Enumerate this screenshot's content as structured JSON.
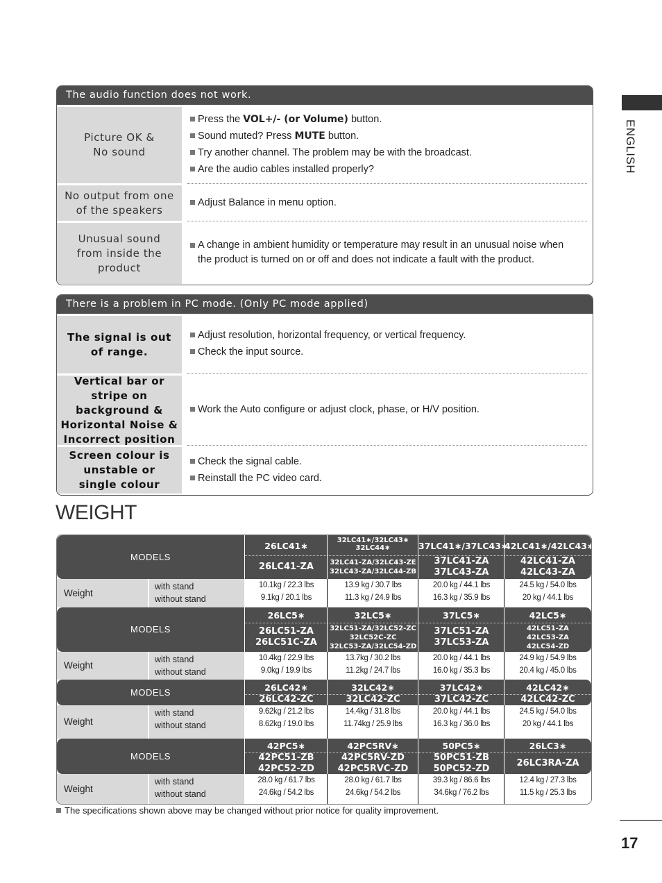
{
  "sidebar": {
    "language": "ENGLISH"
  },
  "page_number": "17",
  "audio_panel": {
    "title": "The audio function does not work.",
    "rows": [
      {
        "problem": "Picture OK & No sound",
        "solutions": [
          {
            "pre": "Press the ",
            "bold": "VOL+/- (or Volume)",
            "post": " button."
          },
          {
            "pre": "Sound muted? Press ",
            "bold": "MUTE",
            "post": " button."
          },
          {
            "pre": "Try another channel. The problem may be with the broadcast.",
            "bold": "",
            "post": ""
          },
          {
            "pre": "Are the audio cables installed properly?",
            "bold": "",
            "post": ""
          }
        ]
      },
      {
        "problem": "No output from one of the speakers",
        "solutions": [
          {
            "pre": "Adjust Balance in menu option.",
            "bold": "",
            "post": ""
          }
        ]
      },
      {
        "problem": "Unusual sound from inside the product",
        "solutions": [
          {
            "pre": "A change in ambient humidity or temperature may result in an unusual noise when",
            "bold": "",
            "post": "",
            "cont": "the product is turned on or off and does not indicate a fault with the product."
          }
        ]
      }
    ]
  },
  "pc_panel": {
    "title": "There is a problem in PC mode. (Only PC mode applied)",
    "rows": [
      {
        "problem": "The signal is out of range.",
        "solutions": [
          "Adjust resolution, horizontal frequency, or vertical frequency.",
          "Check the input source."
        ]
      },
      {
        "problem": "Vertical bar or stripe on background & Horizontal Noise & Incorrect position",
        "solutions": [
          "Work the Auto configure or adjust clock, phase, or H/V position."
        ]
      },
      {
        "problem": "Screen colour is unstable or single colour",
        "solutions": [
          "Check the signal cable.",
          "Reinstall the PC video card."
        ]
      }
    ]
  },
  "weight": {
    "title": "WEIGHT",
    "models_label": "MODELS",
    "weight_label": "Weight",
    "with_stand_label": "with stand",
    "without_stand_label": "without stand",
    "groups": [
      {
        "models": [
          {
            "series": "26LC41*",
            "variants": [
              "26LC41-ZA"
            ],
            "with_stand": "10.1kg / 22.3 lbs",
            "without_stand": "9.1kg / 20.1 lbs"
          },
          {
            "series": "32LC41*/32LC43* 32LC44*",
            "variants": [
              "32LC41-ZA/32LC43-ZE",
              "32LC43-ZA/32LC44-ZB"
            ],
            "with_stand": "13.9 kg / 30.7 lbs",
            "without_stand": "11.3 kg / 24.9 lbs"
          },
          {
            "series": "37LC41*/37LC43*",
            "variants": [
              "37LC41-ZA",
              "37LC43-ZA"
            ],
            "with_stand": "20.0 kg / 44.1 lbs",
            "without_stand": "16.3 kg / 35.9 lbs"
          },
          {
            "series": "42LC41*/42LC43*",
            "variants": [
              "42LC41-ZA",
              "42LC43-ZA"
            ],
            "with_stand": "24.5 kg / 54.0 lbs",
            "without_stand": "20 kg / 44.1 lbs"
          }
        ]
      },
      {
        "models": [
          {
            "series": "26LC5*",
            "variants": [
              "26LC51-ZA",
              "26LC51C-ZA"
            ],
            "with_stand": "10.4kg / 22.9 lbs",
            "without_stand": "9.0kg / 19.9 lbs"
          },
          {
            "series": "32LC5*",
            "variants": [
              "32LC51-ZA/32LC52-ZC",
              "32LC52C-ZC",
              "32LC53-ZA/32LC54-ZD"
            ],
            "with_stand": "13.7kg / 30.2 lbs",
            "without_stand": "11.2kg / 24.7 lbs"
          },
          {
            "series": "37LC5*",
            "variants": [
              "37LC51-ZA",
              "37LC53-ZA"
            ],
            "with_stand": "20.0 kg / 44.1 lbs",
            "without_stand": "16.0 kg / 35.3 lbs"
          },
          {
            "series": "42LC5*",
            "variants": [
              "42LC51-ZA",
              "42LC53-ZA",
              "42LC54-ZD"
            ],
            "with_stand": "24.9 kg / 54.9 lbs",
            "without_stand": "20.4 kg / 45.0 lbs"
          }
        ]
      },
      {
        "models": [
          {
            "series": "26LC42*",
            "variants": [
              "26LC42-ZC"
            ],
            "with_stand": "9.62kg / 21.2 lbs",
            "without_stand": "8.62kg / 19.0 lbs"
          },
          {
            "series": "32LC42*",
            "variants": [
              "32LC42-ZC"
            ],
            "with_stand": "14.4kg / 31.8 lbs",
            "without_stand": "11.74kg / 25.9 lbs"
          },
          {
            "series": "37LC42*",
            "variants": [
              "37LC42-ZC"
            ],
            "with_stand": "20.0 kg / 44.1 lbs",
            "without_stand": "16.3 kg / 36.0 lbs"
          },
          {
            "series": "42LC42*",
            "variants": [
              "42LC42-ZC"
            ],
            "with_stand": "24.5 kg / 54.0 lbs",
            "without_stand": "20 kg / 44.1 lbs"
          }
        ]
      },
      {
        "models": [
          {
            "series": "42PC5*",
            "variants": [
              "42PC51-ZB",
              "42PC52-ZD"
            ],
            "with_stand": "28.0 kg / 61.7 lbs",
            "without_stand": "24.6kg / 54.2 lbs"
          },
          {
            "series": "42PC5RV*",
            "variants": [
              "42PC5RV-ZD",
              "42PC5RVC-ZD"
            ],
            "with_stand": "28.0 kg / 61.7 lbs",
            "without_stand": "24.6kg / 54.2 lbs"
          },
          {
            "series": "50PC5*",
            "variants": [
              "50PC51-ZB",
              "50PC52-ZD"
            ],
            "with_stand": "39.3 kg / 86.6 lbs",
            "without_stand": "34.6kg / 76.2 lbs"
          },
          {
            "series": "26LC3*",
            "variants": [
              "26LC3RA-ZA"
            ],
            "with_stand": "12.4 kg / 27.3 lbs",
            "without_stand": "11.5 kg / 25.3 lbs"
          }
        ]
      }
    ],
    "footnote": "The specifications shown above may be changed without prior notice for quality improvement."
  }
}
